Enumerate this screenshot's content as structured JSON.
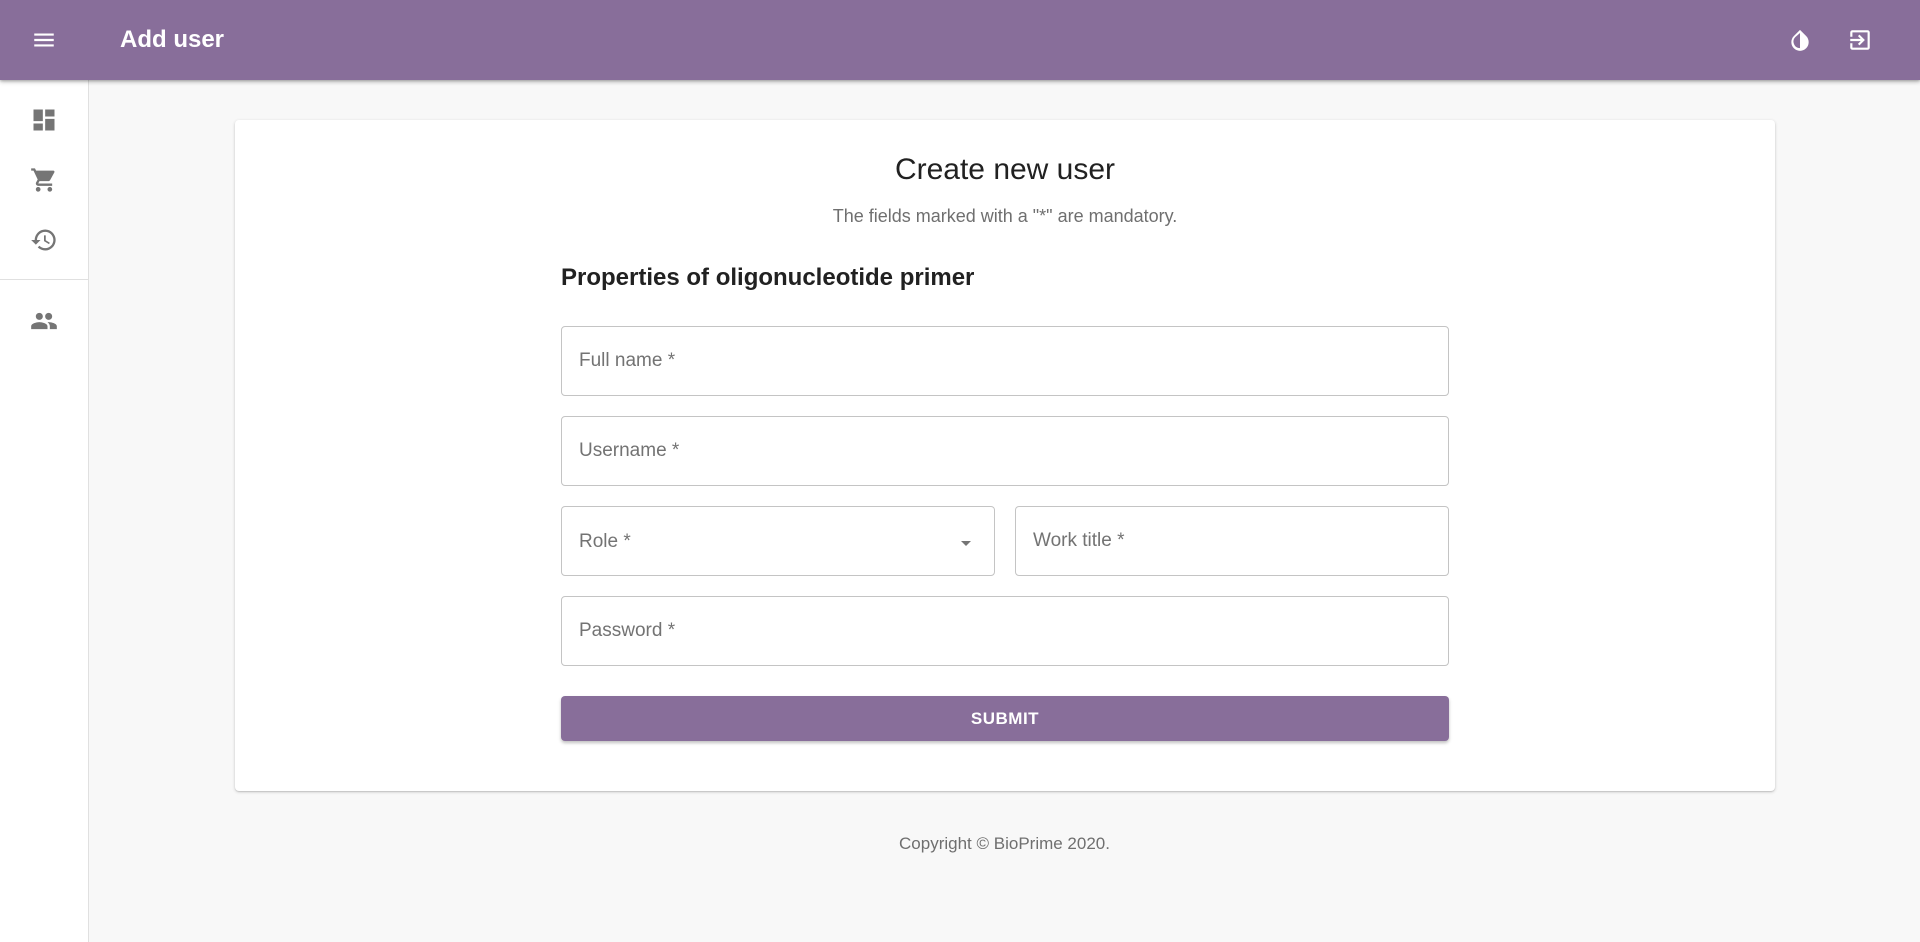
{
  "app": {
    "title": "Add user",
    "accent_color": "#886e9a",
    "menu_icon": "menu-icon",
    "actions": [
      {
        "name": "theme-toggle",
        "icon": "contrast-icon"
      },
      {
        "name": "logout",
        "icon": "exit-icon"
      }
    ]
  },
  "sidebar": {
    "items": [
      {
        "name": "dashboard",
        "icon": "dashboard-icon"
      },
      {
        "name": "cart",
        "icon": "cart-icon"
      },
      {
        "name": "history",
        "icon": "history-icon"
      },
      {
        "name": "users",
        "icon": "users-icon"
      }
    ]
  },
  "form": {
    "title": "Create new user",
    "subtitle": "The fields marked with a \"*\" are mandatory.",
    "section_heading": "Properties of oligonucleotide primer",
    "full_name": {
      "placeholder": "Full name *",
      "value": ""
    },
    "username": {
      "placeholder": "Username *",
      "value": ""
    },
    "role": {
      "label": "Role *",
      "value": ""
    },
    "work_title": {
      "placeholder": "Work title *",
      "value": ""
    },
    "password": {
      "placeholder": "Password *",
      "value": ""
    },
    "submit_label": "SUBMIT"
  },
  "footer": {
    "copyright": "Copyright © BioPrime 2020."
  }
}
